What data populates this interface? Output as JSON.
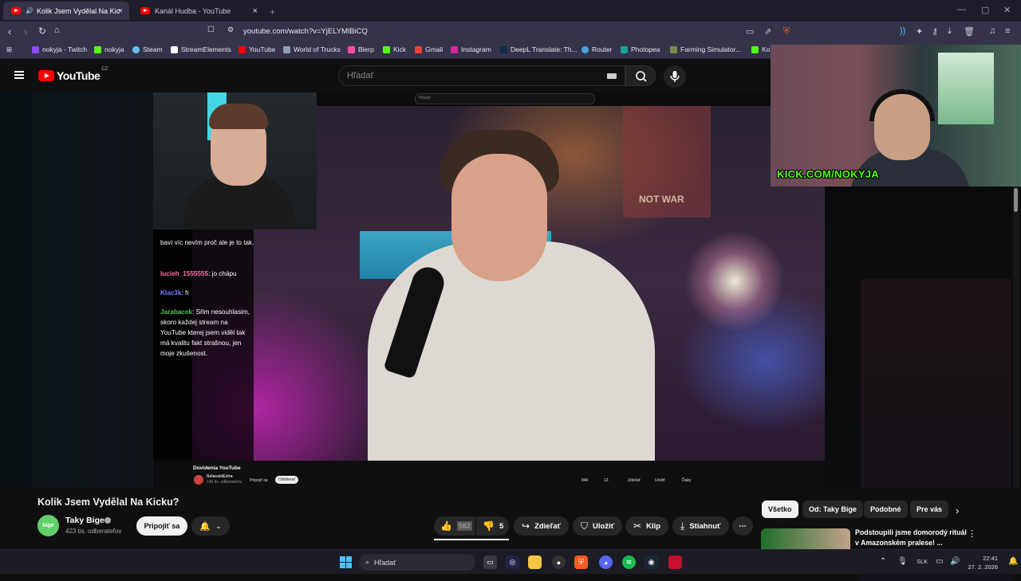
{
  "browser": {
    "tabs": [
      {
        "label": "Kolik Jsem Vydělal Na Kicku?"
      },
      {
        "label": "Kanál Hudba - YouTube"
      }
    ],
    "new_tab": "+",
    "url": "youtube.com/watch?v=YjELYMlBiCQ",
    "bookmarks": [
      {
        "label": "nokyja - Twitch",
        "color": "#9146ff"
      },
      {
        "label": "nokyja",
        "color": "#53fc18"
      },
      {
        "label": "Steam",
        "color": "#66c0f4"
      },
      {
        "label": "StreamElements",
        "color": "#ffffff"
      },
      {
        "label": "YouTube",
        "color": "#ff0000"
      },
      {
        "label": "World of Trucks",
        "color": "#8fa0b0"
      },
      {
        "label": "Blerp",
        "color": "#ff4fa0"
      },
      {
        "label": "Kick",
        "color": "#53fc18"
      },
      {
        "label": "Gmail",
        "color": "#ea4335"
      },
      {
        "label": "Instagram",
        "color": "#d6249f"
      },
      {
        "label": "DeepL Translate: Th...",
        "color": "#0f2b46"
      },
      {
        "label": "Router",
        "color": "#4aa3df"
      },
      {
        "label": "Photopea",
        "color": "#18a497"
      },
      {
        "label": "Farming Simulator...",
        "color": "#7a8a4a"
      },
      {
        "label": "Ko",
        "color": "#53fc18"
      }
    ]
  },
  "youtube": {
    "logo_text": "YouTube",
    "logo_region": "CZ",
    "search_placeholder": "Hľadať"
  },
  "video": {
    "poster_text": "NOT WAR",
    "inner_search_placeholder": "Hľadať",
    "chat": [
      {
        "user": "",
        "text": "baví víc nevím proč ale je to tak.",
        "color": "#ffffff"
      },
      {
        "user": "lucieh_1555555",
        "text": "jo chápu",
        "color": "#ff6fa5"
      },
      {
        "user": "Klac3k",
        "text": "fr",
        "color": "#6f7dff"
      },
      {
        "user": "Jarabacek",
        "text": "Sŕim nesouhlasim, skoro každej stream na YouTube kterej jsem viděl tak má kvalitu fakt strašnou, jen moje zkušenost.",
        "color": "#4fc24f"
      }
    ],
    "mini_title": "Dovidenia YouTube",
    "mini_channel": "SelassieExtra",
    "mini_subs": "140 tis. odberateľov",
    "mini_join": "Pripojiť sa",
    "mini_subscribe": "Odoberať",
    "mini_likes": "846",
    "mini_dislikes": "13",
    "mini_share": "Zdieľať",
    "mini_save": "Uložiť",
    "mini_thanks": "Ďaky",
    "kick_label": "KICK.COM/NOKYJA"
  },
  "details": {
    "title": "Kolik Jsem Vydělal Na Kicku?",
    "channel_name": "Taky Bige",
    "channel_avatar_text": "bige",
    "subscribers": "423 tis. odberateľov",
    "join_label": "Pripojiť sa",
    "like_count": "562",
    "dislike_count": "5",
    "share_label": "Zdieľať",
    "save_label": "Uložiť",
    "clip_label": "Klip",
    "download_label": "Stiahnuť",
    "chips": [
      "Všetko",
      "Od: Taky Bige",
      "Podobné",
      "Pre vás"
    ],
    "recommended_title": "Podstoupili jsme domorodý rituál v Amazonském pralese! ..."
  },
  "taskbar": {
    "search_placeholder": "Hľadať",
    "language": "SLK",
    "time": "22:41",
    "date": "27. 2. 2026"
  }
}
